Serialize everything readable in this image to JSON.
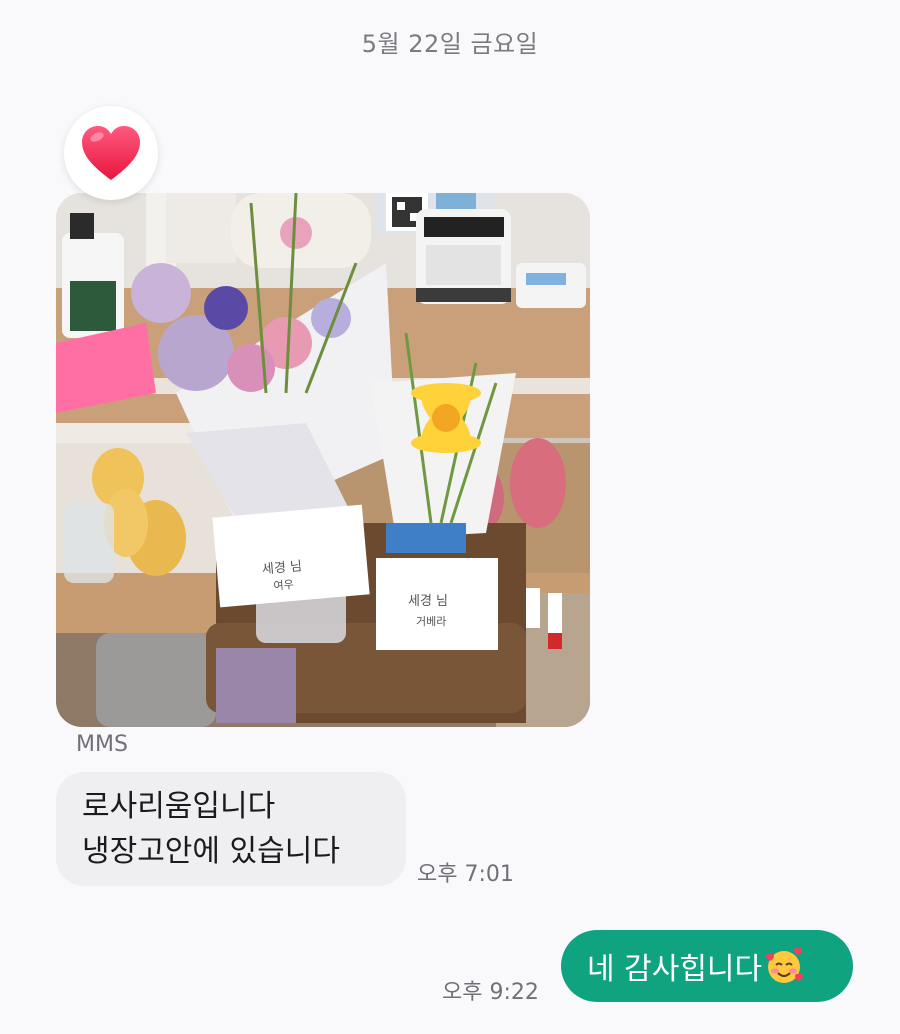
{
  "header": {
    "date": "5월 22일 금요일"
  },
  "incoming": {
    "reaction": "heart-icon",
    "photo": {
      "subject": "bouquets",
      "note_left_lines": [
        "세경 님",
        "여우"
      ],
      "note_right_lines": [
        "세경 님",
        "거베라"
      ]
    },
    "type_label": "MMS",
    "lines": [
      "로사리움입니다",
      "냉장고안에 있습니다"
    ],
    "time": "오후 7:01"
  },
  "outgoing": {
    "text": "네 감사힙니다",
    "emoji": "smiling-face-with-hearts-icon",
    "time": "오후 9:22"
  },
  "colors": {
    "background": "#f9f9fc",
    "incoming_bubble": "#efeff2",
    "outgoing_bubble": "#10a37f",
    "timestamp": "#707078"
  }
}
